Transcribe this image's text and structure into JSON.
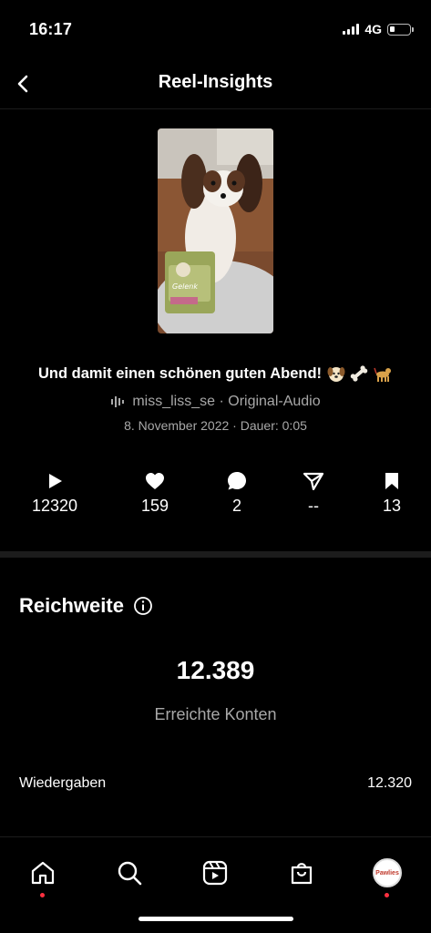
{
  "status_bar": {
    "time": "16:17",
    "network": "4G"
  },
  "header": {
    "title": "Reel-Insights"
  },
  "reel": {
    "caption": "Und damit einen schönen guten Abend!",
    "audio": "miss_liss_se · Original-Audio",
    "meta": "8. November 2022 · Dauer: 0:05",
    "package_label": "Gelenk"
  },
  "stats": {
    "plays": "12320",
    "likes": "159",
    "comments": "2",
    "shares": "--",
    "saves": "13"
  },
  "reach": {
    "title": "Reichweite",
    "value": "12.389",
    "label": "Erreichte Konten",
    "rows": [
      {
        "label": "Wiedergaben",
        "value": "12.320"
      }
    ]
  },
  "nav": {
    "profile_label": "Pawlies"
  },
  "colors": {
    "background": "#000000",
    "muted": "#a8a8a8",
    "notification": "#ff3040"
  }
}
